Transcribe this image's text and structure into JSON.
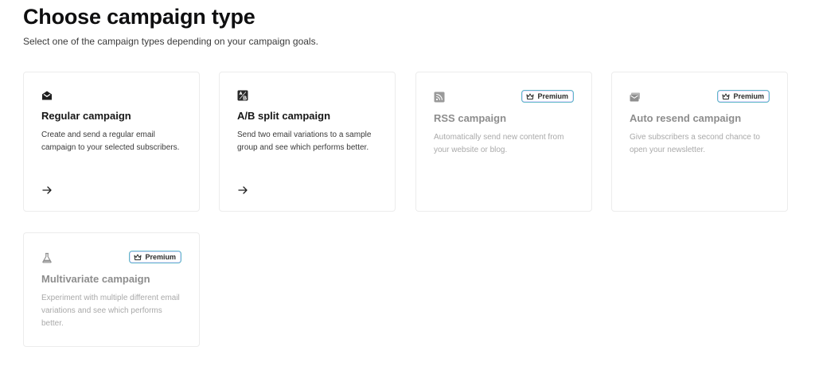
{
  "page": {
    "title": "Choose campaign type",
    "subtitle": "Select one of the campaign types depending on your campaign goals."
  },
  "colors": {
    "active_title": "#161616",
    "disabled_title": "#8d8d8d",
    "disabled_desc": "#a9a9a9",
    "badge_border": "#5fb8c7"
  },
  "cards": [
    {
      "title": "Regular campaign",
      "description": "Create and send a regular email campaign to your selected subscribers.",
      "icon": "envelope-open-icon",
      "premium": false
    },
    {
      "title": "A/B split campaign",
      "description": "Send two email variations to a sample group and see which performs better.",
      "icon": "ab-split-icon",
      "premium": false
    },
    {
      "title": "RSS campaign",
      "description": "Automatically send new content from your website or blog.",
      "icon": "rss-icon",
      "premium": true,
      "badge_label": "Premium"
    },
    {
      "title": "Auto resend campaign",
      "description": "Give subscribers a second chance to open your newsletter.",
      "icon": "resend-envelope-icon",
      "premium": true,
      "badge_label": "Premium"
    },
    {
      "title": "Multivariate campaign",
      "description": "Experiment with multiple different email variations and see which performs better.",
      "icon": "flask-icon",
      "premium": true,
      "badge_label": "Premium"
    }
  ]
}
